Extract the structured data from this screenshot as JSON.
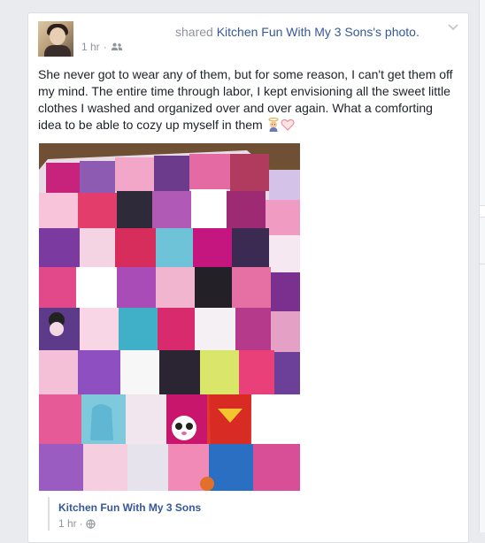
{
  "post": {
    "action_prefix": "shared",
    "page_name": "Kitchen Fun With My 3 Sons",
    "action_suffix": "'s photo.",
    "time": "1 hr",
    "separator": "·",
    "privacy_icon": "friends-icon",
    "text": "She never got to wear any of them, but for some reason, I can't get them off my mind. The entire time through labor, I kept envisioning all the sweet little clothes I washed and organized over and over again. What a comforting idea to be able to cozy up myself in them",
    "emojis": [
      "angel-emoji",
      "heart-emoji"
    ]
  },
  "photo": {
    "subject": "memory quilt of baby clothes"
  },
  "attribution": {
    "name": "Kitchen Fun With My 3 Sons",
    "time": "1 hr",
    "separator": "·",
    "privacy_icon": "globe-icon"
  },
  "colors": {
    "link": "#365899",
    "muted": "#90949c",
    "text": "#1d2129",
    "background": "#e9ebee"
  }
}
